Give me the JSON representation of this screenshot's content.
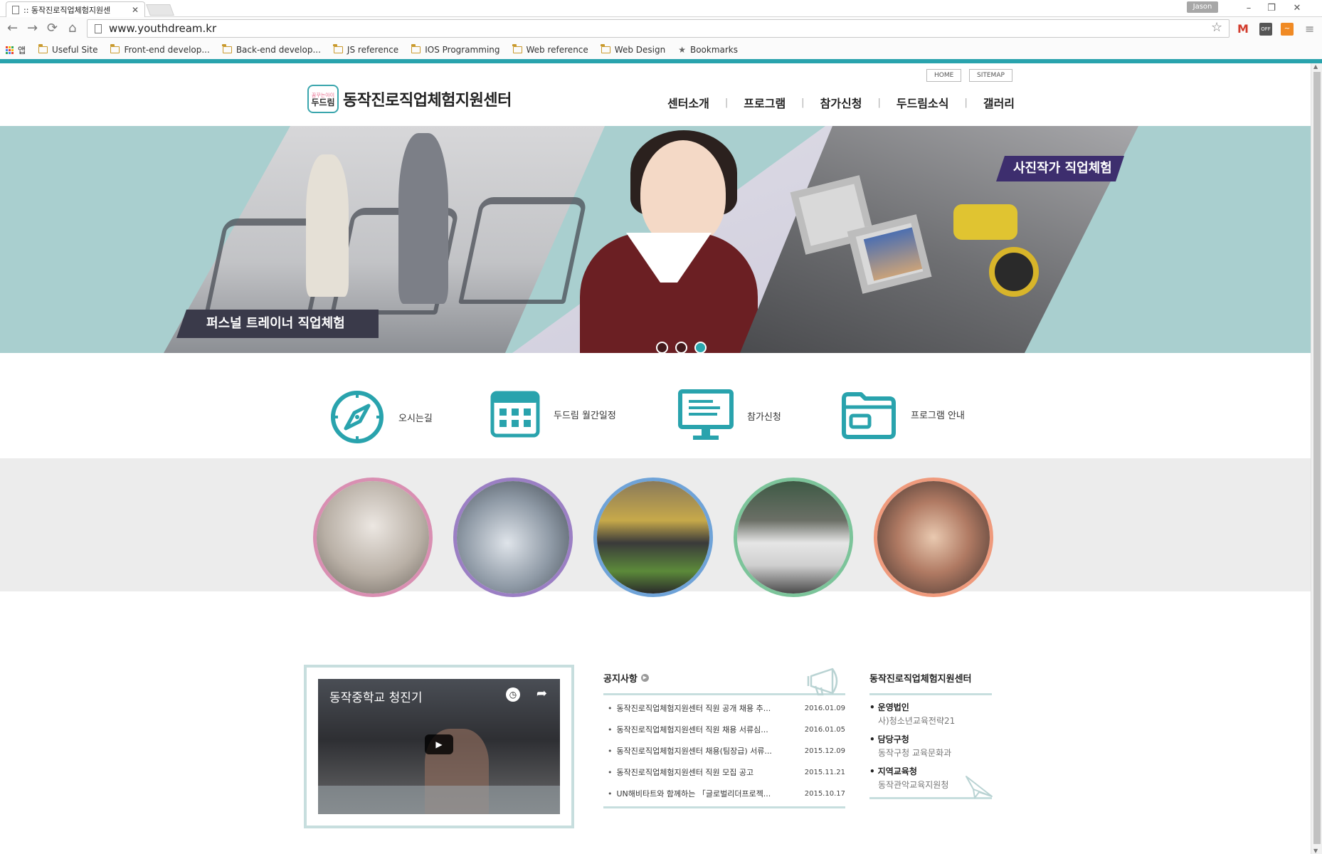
{
  "browser": {
    "tab_title": ":: 동작진로직업체험지원센",
    "profile_name": "Jason",
    "url": "www.youthdream.kr",
    "bookmarks": [
      {
        "label": "앱",
        "icon": "apps-icon"
      },
      {
        "label": "Useful Site",
        "icon": "folder-icon"
      },
      {
        "label": "Front-end develop...",
        "icon": "folder-icon"
      },
      {
        "label": "Back-end develop...",
        "icon": "folder-icon"
      },
      {
        "label": "JS reference",
        "icon": "folder-icon"
      },
      {
        "label": "IOS Programming",
        "icon": "folder-icon"
      },
      {
        "label": "Web reference",
        "icon": "folder-icon"
      },
      {
        "label": "Web Design",
        "icon": "folder-icon"
      },
      {
        "label": "Bookmarks",
        "icon": "star-icon"
      }
    ],
    "extensions": [
      {
        "label": "M",
        "color": "#d23c2d"
      },
      {
        "label": "OFF",
        "color": "#555555"
      },
      {
        "label": "~",
        "color": "#f08a24"
      }
    ]
  },
  "site": {
    "brand_color": "#29a3ad",
    "util_links": {
      "home": "HOME",
      "sitemap": "SITEMAP"
    },
    "logo": {
      "small_top": "꿈꾸는아이",
      "small_main": "두드림",
      "title": "동작진로직업체험지원센터"
    },
    "nav": [
      "센터소개",
      "프로그램",
      "참가신청",
      "두드림소식",
      "갤러리"
    ],
    "hero": {
      "caption_left": "퍼스널 트레이너 직업체험",
      "caption_right": "사진작가 직업체험",
      "slides": 3,
      "active_slide": 3
    },
    "quick_menu": [
      {
        "label": "오시는길",
        "icon": "compass-icon"
      },
      {
        "label": "두드림 월간일정",
        "icon": "calendar-icon"
      },
      {
        "label": "참가신청",
        "icon": "monitor-icon"
      },
      {
        "label": "프로그램 안내",
        "icon": "folder-open-icon"
      }
    ],
    "gallery_circles": [
      {
        "name": "pilot-experience",
        "color": "#d98fb2"
      },
      {
        "name": "map-activity",
        "color": "#9b7fc4"
      },
      {
        "name": "classroom",
        "color": "#6fa3d8"
      },
      {
        "name": "tshirt-design",
        "color": "#7cc49a"
      },
      {
        "name": "hands-craft",
        "color": "#ef9a7c"
      }
    ],
    "video": {
      "title": "동작중학교 청진기"
    },
    "notice": {
      "heading": "공지사항",
      "items": [
        {
          "title": "동작진로직업체험지원센터 직원 공개 채용 추...",
          "date": "2016.01.09"
        },
        {
          "title": "동작진로직업체험지원센터 직원 채용 서류심...",
          "date": "2016.01.05"
        },
        {
          "title": "동작진로직업체험지원센터 채용(팀장급) 서류...",
          "date": "2015.12.09"
        },
        {
          "title": "동작진로직업체험지원센터 직원 모집 공고",
          "date": "2015.11.21"
        },
        {
          "title": "UN해비타트와 함께하는 「글로벌리더프로젝...",
          "date": "2015.10.17"
        }
      ]
    },
    "center_info": {
      "heading": "동작진로직업체험지원센터",
      "items": [
        {
          "key": "운영법인",
          "value": "사)청소년교육전략21"
        },
        {
          "key": "담당구청",
          "value": "동작구청 교육문화과"
        },
        {
          "key": "지역교육청",
          "value": "동작관악교육지원청"
        }
      ]
    }
  }
}
